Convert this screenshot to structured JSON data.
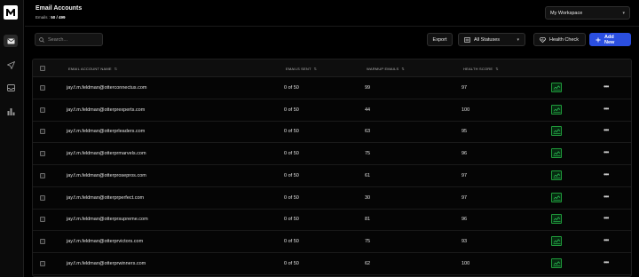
{
  "nav": {
    "logo_icon": "logo-m-icon",
    "items": [
      {
        "icon": "mail-icon",
        "active": true
      },
      {
        "icon": "send-icon",
        "active": false
      },
      {
        "icon": "inbox-icon",
        "active": false
      },
      {
        "icon": "bar-chart-icon",
        "active": false
      }
    ]
  },
  "header": {
    "title": "Email Accounts",
    "count_label": "Emails :",
    "count_value": "50 / 499",
    "workspace": "My Workspace"
  },
  "toolbar": {
    "search_placeholder": "Search...",
    "export_label": "Export",
    "status_label": "All Statuses",
    "health_label": "Health Check",
    "add_label": "Add New"
  },
  "colors": {
    "accent": "#2b4fe0",
    "health_green": "#1f9a3a",
    "background": "#000000"
  },
  "table": {
    "columns": [
      "EMAIL ACCOUNT NAME",
      "EMAILS SENT",
      "WARMUP EMAILS",
      "HEALTH SCORE"
    ],
    "rows": [
      {
        "email": "jay.f.m.feldman@otterconnectus.com",
        "sent": "0 of 50",
        "warmup": "99",
        "score": "97"
      },
      {
        "email": "jay.f.m.feldman@otterprexperts.com",
        "sent": "0 of 50",
        "warmup": "44",
        "score": "100"
      },
      {
        "email": "jay.f.m.feldman@otterprleaders.com",
        "sent": "0 of 50",
        "warmup": "63",
        "score": "95"
      },
      {
        "email": "jay.f.m.feldman@otterprmarvels.com",
        "sent": "0 of 50",
        "warmup": "75",
        "score": "96"
      },
      {
        "email": "jay.f.m.feldman@otterprosepros.com",
        "sent": "0 of 50",
        "warmup": "61",
        "score": "97"
      },
      {
        "email": "jay.f.m.feldman@otterprperfect.com",
        "sent": "0 of 50",
        "warmup": "30",
        "score": "97"
      },
      {
        "email": "jay.f.m.feldman@otterprsupreme.com",
        "sent": "0 of 50",
        "warmup": "81",
        "score": "96"
      },
      {
        "email": "jay.f.m.feldman@otterprvictors.com",
        "sent": "0 of 50",
        "warmup": "75",
        "score": "93"
      },
      {
        "email": "jay.f.m.feldman@otterprwinners.com",
        "sent": "0 of 50",
        "warmup": "62",
        "score": "100"
      }
    ]
  }
}
